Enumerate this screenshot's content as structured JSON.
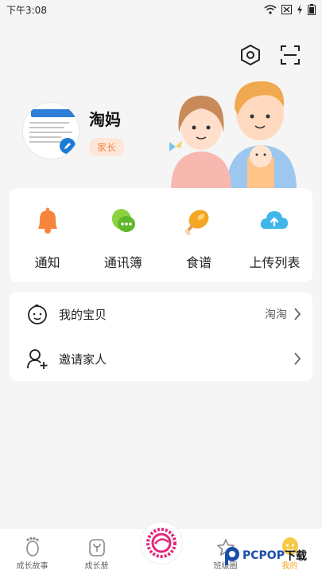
{
  "status_bar": {
    "time": "下午3:08"
  },
  "profile": {
    "name": "淘妈",
    "role": "家长"
  },
  "grid": [
    {
      "label": "通知",
      "icon": "bell-icon",
      "color": "#f7843c"
    },
    {
      "label": "通讯簿",
      "icon": "chat-icon",
      "color": "#8cd13f"
    },
    {
      "label": "食谱",
      "icon": "drumstick-icon",
      "color": "#f5a623"
    },
    {
      "label": "上传列表",
      "icon": "cloud-upload-icon",
      "color": "#3fb6e8"
    }
  ],
  "list": [
    {
      "label": "我的宝贝",
      "value": "淘淘",
      "icon": "baby-face-icon"
    },
    {
      "label": "邀请家人",
      "value": "",
      "icon": "add-user-icon"
    }
  ],
  "tabs": [
    {
      "label": "成长故事",
      "icon": "footprint-icon"
    },
    {
      "label": "成长册",
      "icon": "sprout-book-icon"
    },
    {
      "label": "",
      "icon": "center-logo-icon"
    },
    {
      "label": "班级圈",
      "icon": "star-icon"
    },
    {
      "label": "我的",
      "icon": "me-icon"
    }
  ],
  "watermark": {
    "brand": "PCPOP",
    "suffix": "下载"
  },
  "colors": {
    "accent": "#f5a623",
    "badge_text": "#f08a4b",
    "badge_bg": "#fde7d8"
  }
}
